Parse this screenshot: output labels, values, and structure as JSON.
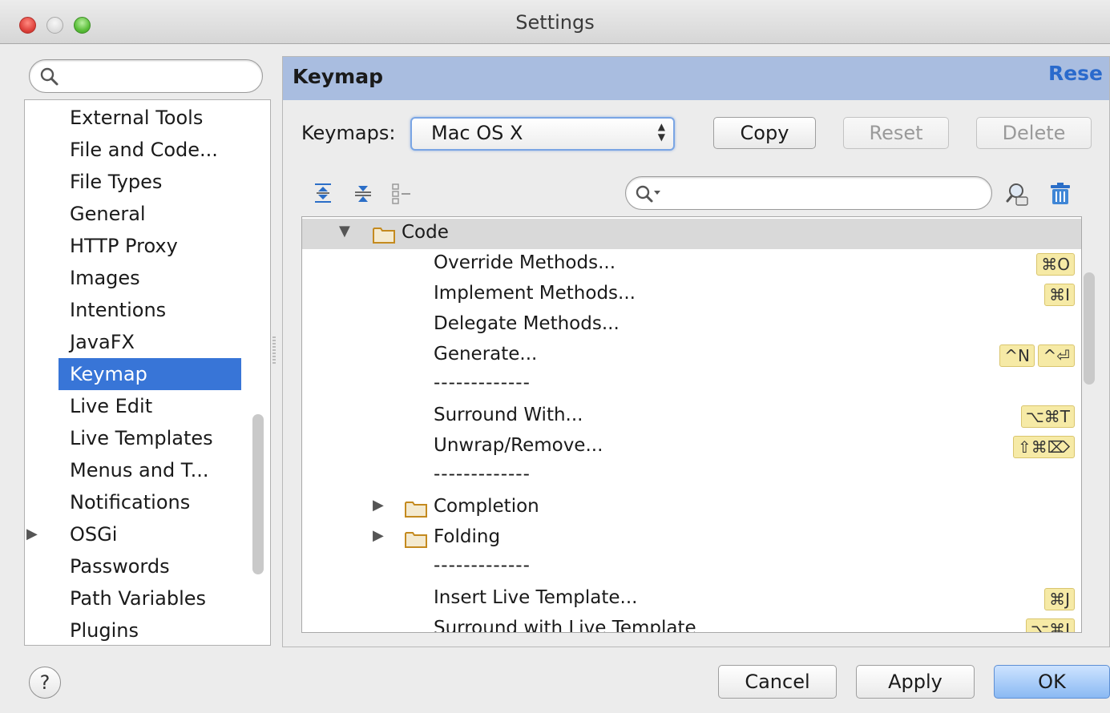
{
  "window": {
    "title": "Settings"
  },
  "sidebar": {
    "search_placeholder": "",
    "items": [
      {
        "label": "External Tools"
      },
      {
        "label": "File and Code..."
      },
      {
        "label": "File Types"
      },
      {
        "label": "General"
      },
      {
        "label": "HTTP Proxy"
      },
      {
        "label": "Images"
      },
      {
        "label": "Intentions"
      },
      {
        "label": "JavaFX"
      },
      {
        "label": "Keymap",
        "selected": true
      },
      {
        "label": "Live Edit"
      },
      {
        "label": "Live Templates"
      },
      {
        "label": "Menus and T..."
      },
      {
        "label": "Notifications"
      },
      {
        "label": "OSGi",
        "expandable": true
      },
      {
        "label": "Passwords"
      },
      {
        "label": "Path Variables"
      },
      {
        "label": "Plugins"
      }
    ]
  },
  "panel": {
    "title": "Keymap",
    "reset_link": "Rese",
    "keymaps_label": "Keymaps:",
    "keymap_selected": "Mac OS X",
    "copy_label": "Copy",
    "reset_label": "Reset",
    "delete_label": "Delete",
    "filter_placeholder": ""
  },
  "tree": {
    "group": "Code",
    "actions": [
      {
        "label": "Override Methods...",
        "shortcuts": [
          "⌘O"
        ]
      },
      {
        "label": "Implement Methods...",
        "shortcuts": [
          "⌘I"
        ]
      },
      {
        "label": "Delegate Methods...",
        "shortcuts": []
      },
      {
        "label": "Generate...",
        "shortcuts": [
          "^N",
          "^⏎"
        ]
      },
      {
        "separator": "-------------"
      },
      {
        "label": "Surround With...",
        "shortcuts": [
          "⌥⌘T"
        ]
      },
      {
        "label": "Unwrap/Remove...",
        "shortcuts": [
          "⇧⌘⌦"
        ]
      },
      {
        "separator": "-------------"
      },
      {
        "folder": "Completion"
      },
      {
        "folder": "Folding"
      },
      {
        "separator": "-------------"
      },
      {
        "label": "Insert Live Template...",
        "shortcuts": [
          "⌘J"
        ]
      },
      {
        "label": "Surround with Live Template",
        "shortcuts": [
          "⌥⌘J"
        ]
      }
    ]
  },
  "footer": {
    "help_label": "?",
    "cancel_label": "Cancel",
    "apply_label": "Apply",
    "ok_label": "OK"
  }
}
